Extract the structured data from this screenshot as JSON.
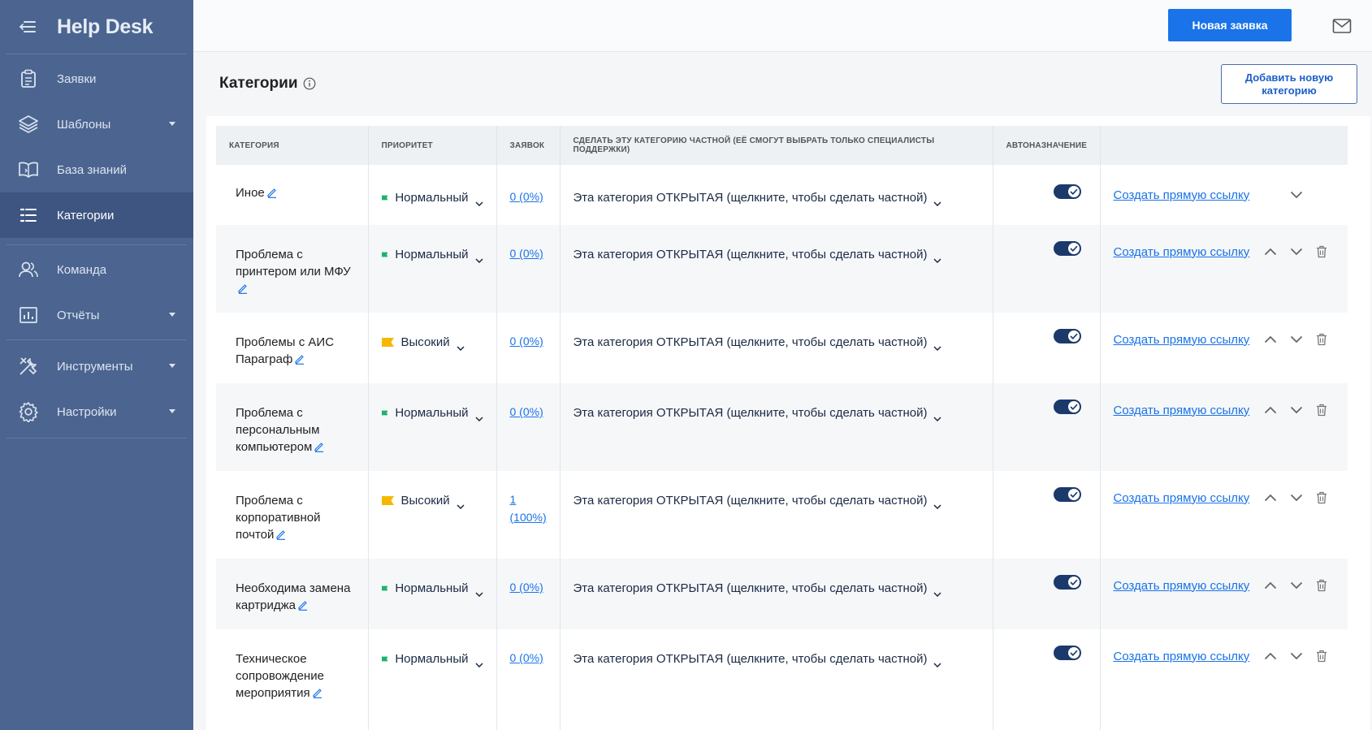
{
  "app": {
    "title": "Help Desk"
  },
  "sidebar": {
    "items": [
      {
        "label": "Заявки",
        "icon": "clipboard-icon",
        "has_caret": false,
        "active": false
      },
      {
        "label": "Шаблоны",
        "icon": "layers-icon",
        "has_caret": true,
        "active": false
      },
      {
        "label": "База знаний",
        "icon": "book-icon",
        "has_caret": false,
        "active": false
      },
      {
        "label": "Категории",
        "icon": "list-icon",
        "has_caret": false,
        "active": true
      },
      {
        "label": "Команда",
        "icon": "users-icon",
        "has_caret": false,
        "active": false
      },
      {
        "label": "Отчёты",
        "icon": "chart-icon",
        "has_caret": true,
        "active": false
      },
      {
        "label": "Инструменты",
        "icon": "tools-icon",
        "has_caret": true,
        "active": false
      },
      {
        "label": "Настройки",
        "icon": "gear-icon",
        "has_caret": true,
        "active": false
      }
    ]
  },
  "topbar": {
    "new_ticket_label": "Новая заявка"
  },
  "page": {
    "title": "Категории",
    "add_category_label": "Добавить новую категорию"
  },
  "table": {
    "headers": {
      "category": "КАТЕГОРИЯ",
      "priority": "ПРИОРИТЕТ",
      "tickets": "ЗАЯВОК",
      "private": "СДЕЛАТЬ ЭТУ КАТЕГОРИЮ ЧАСТНОЙ (ЕЁ СМОГУТ ВЫБРАТЬ ТОЛЬКО СПЕЦИАЛИСТЫ ПОДДЕРЖКИ)",
      "auto": "АВТОНАЗНАЧЕНИЕ",
      "actions": ""
    },
    "rows": [
      {
        "name": "Иное",
        "priority": "Нормальный",
        "priority_color": "#1db36b",
        "count": "0 (0%)",
        "private": "Эта категория ОТКРЫТАЯ (щелкните, чтобы сделать частной)",
        "auto": true,
        "link": "Создать прямую ссылку",
        "can_up": false,
        "can_delete": false
      },
      {
        "name": "Проблема с принтером или МФУ",
        "priority": "Нормальный",
        "priority_color": "#1db36b",
        "count": "0 (0%)",
        "private": "Эта категория ОТКРЫТАЯ (щелкните, чтобы сделать частной)",
        "auto": true,
        "link": "Создать прямую ссылку",
        "can_up": true,
        "can_delete": true
      },
      {
        "name": "Проблемы с АИС Параграф",
        "priority": "Высокий",
        "priority_color": "#f5b800",
        "count": "0 (0%)",
        "private": "Эта категория ОТКРЫТАЯ (щелкните, чтобы сделать частной)",
        "auto": true,
        "link": "Создать прямую ссылку",
        "can_up": true,
        "can_delete": true
      },
      {
        "name": "Проблема с персональным компьютером",
        "priority": "Нормальный",
        "priority_color": "#1db36b",
        "count": "0 (0%)",
        "private": "Эта категория ОТКРЫТАЯ (щелкните, чтобы сделать частной)",
        "auto": true,
        "link": "Создать прямую ссылку",
        "can_up": true,
        "can_delete": true
      },
      {
        "name": "Проблема с корпоративной почтой",
        "priority": "Высокий",
        "priority_color": "#f5b800",
        "count": "1 (100%)",
        "private": "Эта категория ОТКРЫТАЯ (щелкните, чтобы сделать частной)",
        "auto": true,
        "link": "Создать прямую ссылку",
        "can_up": true,
        "can_delete": true
      },
      {
        "name": "Необходима замена картриджа",
        "priority": "Нормальный",
        "priority_color": "#1db36b",
        "count": "0 (0%)",
        "private": "Эта категория ОТКРЫТАЯ (щелкните, чтобы сделать частной)",
        "auto": true,
        "link": "Создать прямую ссылку",
        "can_up": true,
        "can_delete": true
      },
      {
        "name": "Техническое сопровождение мероприятия",
        "priority": "Нормальный",
        "priority_color": "#1db36b",
        "count": "0 (0%)",
        "private": "Эта категория ОТКРЫТАЯ (щелкните, чтобы сделать частной)",
        "auto": true,
        "link": "Создать прямую ссылку",
        "can_up": true,
        "can_delete": true
      }
    ]
  }
}
